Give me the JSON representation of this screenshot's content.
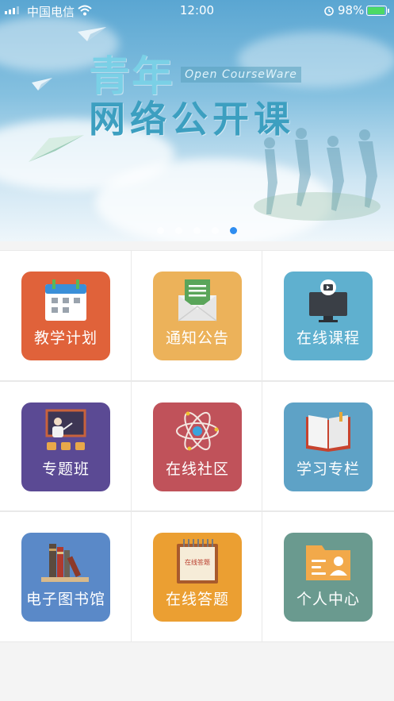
{
  "status_bar": {
    "carrier": "中国电信",
    "time": "12:00",
    "battery": "98%"
  },
  "banner": {
    "title_line1": "青年",
    "title_line2": "网络公开课",
    "subtitle": "Open CourseWare",
    "page_count": 5,
    "active_page": 5
  },
  "menu": [
    {
      "label": "教学计划",
      "icon": "calendar-icon",
      "color": "#e0623a"
    },
    {
      "label": "通知公告",
      "icon": "envelope-icon",
      "color": "#ecb25a"
    },
    {
      "label": "在线课程",
      "icon": "monitor-play-icon",
      "color": "#5fb0cf"
    },
    {
      "label": "专题班",
      "icon": "teacher-board-icon",
      "color": "#5b4a94"
    },
    {
      "label": "在线社区",
      "icon": "atom-icon",
      "color": "#c0525a"
    },
    {
      "label": "学习专栏",
      "icon": "open-book-icon",
      "color": "#5ea2c6"
    },
    {
      "label": "电子图书馆",
      "icon": "books-shelf-icon",
      "color": "#5a89c8"
    },
    {
      "label": "在线答题",
      "icon": "notepad-icon",
      "color": "#eb9f32"
    },
    {
      "label": "个人中心",
      "icon": "folder-id-icon",
      "color": "#6a9a8f"
    }
  ],
  "notepad_text": "在线答题"
}
